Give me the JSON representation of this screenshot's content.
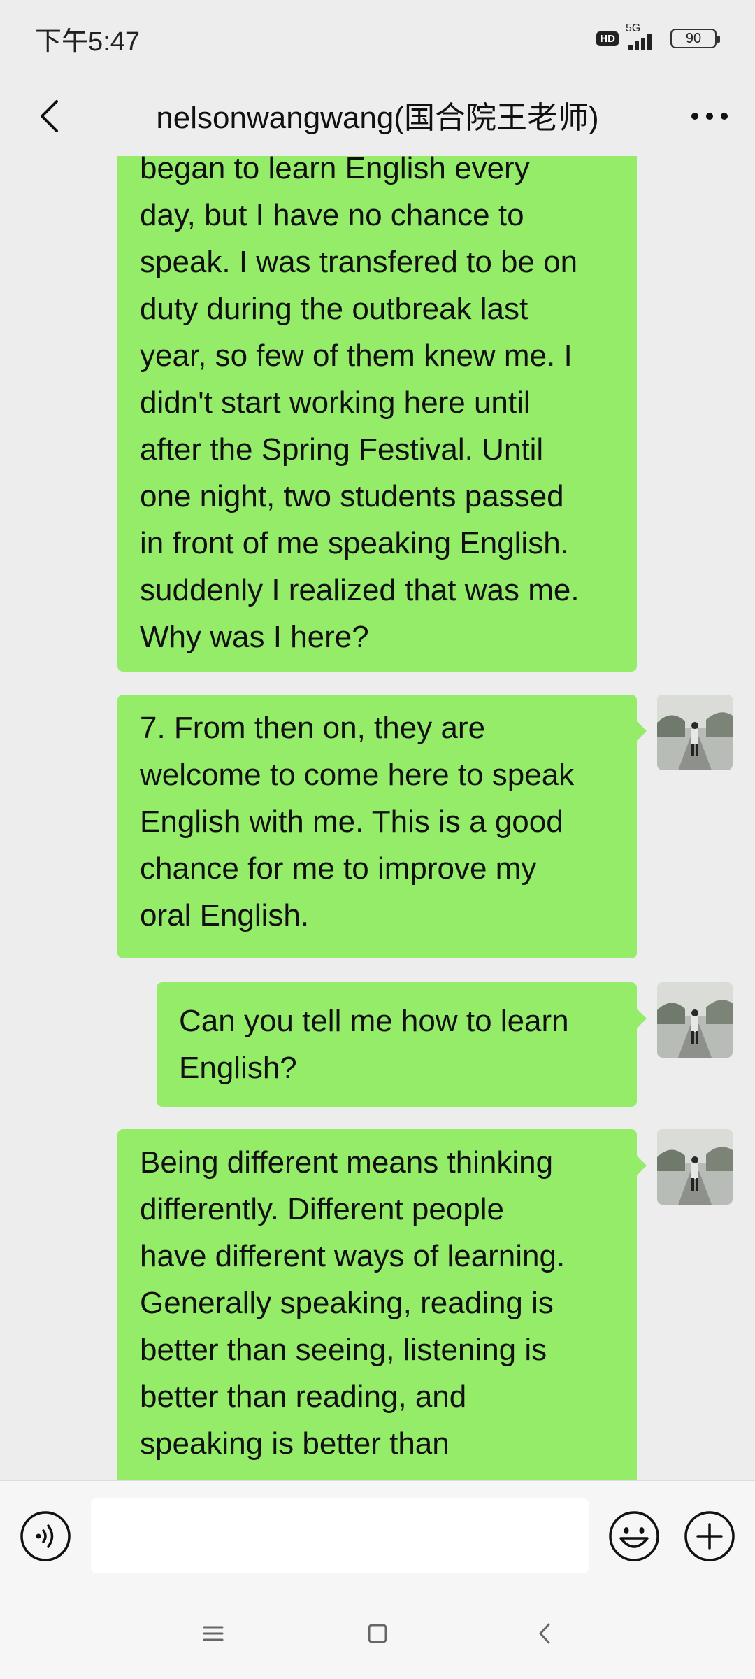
{
  "status_bar": {
    "time": "下午5:47",
    "hd": "HD",
    "network": "5G",
    "battery": "90"
  },
  "header": {
    "title": "nelsonwangwang(国合院王老师)"
  },
  "messages": [
    {
      "lines": [
        "began to learn English every",
        "day, but I have no chance to",
        "speak. I was transfered to be on",
        "duty during the outbreak last",
        "year, so few of them knew me. I",
        "didn't start working here until",
        "after the Spring Festival. Until",
        "one night, two students passed",
        "in front of me speaking English.",
        "suddenly I realized that was me.",
        "Why was I here?"
      ]
    },
    {
      "lines": [
        "7. From then on, they are",
        "welcome to come here to speak",
        "English with me. This is a good",
        "chance for me to improve my",
        "oral English."
      ]
    },
    {
      "lines": [
        "Can you tell me how to learn",
        "English?"
      ]
    },
    {
      "lines": [
        "Being different means thinking",
        "differently. Different people",
        "have different ways of learning.",
        "Generally speaking, reading is",
        "better than seeing, listening is",
        "better than reading, and",
        "speaking is better than"
      ]
    }
  ],
  "input": {
    "value": ""
  },
  "icons": {
    "back": "back-arrow-icon",
    "more": "more-dots-icon",
    "voice": "voice-icon",
    "emoji": "emoji-icon",
    "plus": "plus-icon",
    "menu": "menu-icon",
    "home": "home-icon",
    "sys_back": "back-triangle-icon"
  },
  "colors": {
    "bubble": "#95ec69",
    "background": "#ededed",
    "input_bar": "#f6f6f6"
  }
}
